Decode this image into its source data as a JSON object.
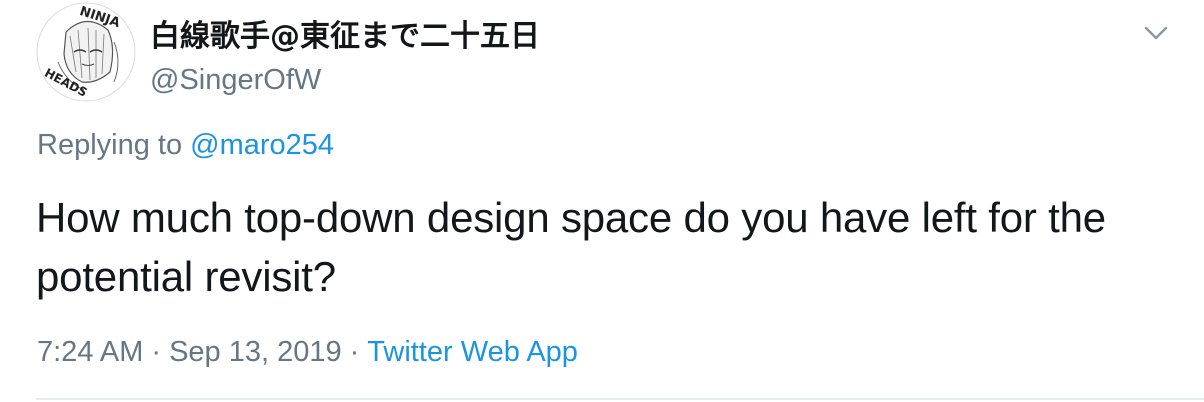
{
  "author": {
    "display_name": "白線歌手@東征まで二十五日",
    "handle": "@SingerOfW",
    "avatar_caption_top": "NINJA",
    "avatar_caption_bottom": "HEADS"
  },
  "reply": {
    "prefix": "Replying to",
    "mention": "@maro254"
  },
  "tweet": {
    "text": "How much top-down design space do you have left for the potential revisit?"
  },
  "meta": {
    "time": "7:24 AM",
    "separator": "·",
    "date": "Sep 13, 2019",
    "source": "Twitter Web App"
  },
  "icons": {
    "menu": "chevron-down-icon",
    "avatar": "avatar-image"
  },
  "colors": {
    "text": "#14171a",
    "secondary": "#657786",
    "link": "#1b95e0",
    "divider": "#e6ecf0"
  }
}
